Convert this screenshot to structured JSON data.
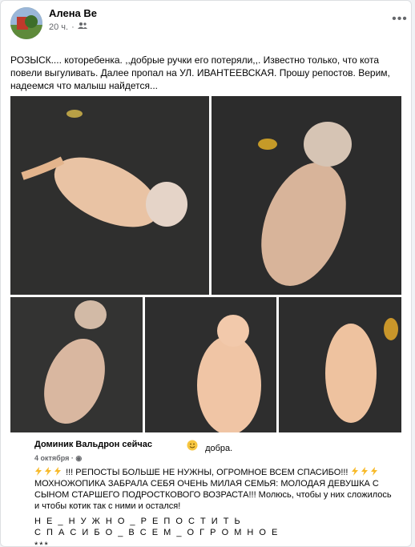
{
  "post": {
    "author": "Алена Ве",
    "time": "20 ч.",
    "audience_icon": "friends-icon",
    "more_icon": "more-horizontal-icon",
    "text": "РОЗЫСК.... которебенка.  ,,добрые ручки его потеряли,,. Известно только, что кота повели выгуливать. Далее пропал на УЛ. ИВАНТЕЕВСКАЯ. Прошу репостов. Верим, надеемся что малыш найдется..."
  },
  "comment": {
    "author": "Доминик Вальдрон сейчас",
    "emoji": "smile-emoji",
    "tail": "добра.",
    "date": "4 октября",
    "line1": "!!! РЕПОСТЫ БОЛЬШЕ НЕ НУЖНЫ, ОГРОМНОЕ ВСЕМ СПАСИБО!!!",
    "line2": "МОХНОЖОПИКА ЗАБРАЛА СЕБЯ ОЧЕНЬ МИЛАЯ СЕМЬЯ: МОЛОДАЯ ДЕВУШКА С СЫНОМ СТАРШЕГО ПОДРОСТКОВОГО ВОЗРАСТА!!! Молюсь, чтобы у них сложилось и чтобы котик так с ними и остался!",
    "line3": "Н Е _ Н У Ж Н О _ Р Е П О С Т И Т Ь",
    "line4": "С П А С И Б О _ В С Е М _ О Г Р О М Н О Е",
    "line5": "***"
  },
  "colors": {
    "bolt": "#f7b928",
    "text": "#050505",
    "muted": "#65676b"
  }
}
